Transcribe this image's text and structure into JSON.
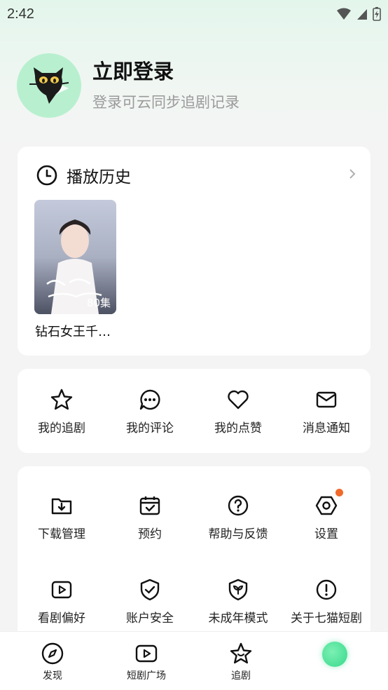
{
  "status_bar": {
    "time": "2:42"
  },
  "profile": {
    "title": "立即登录",
    "subtitle": "登录可云同步追剧记录"
  },
  "history": {
    "title": "播放历史",
    "items": [
      {
        "name": "钻石女王千…",
        "episodes": "80集"
      }
    ]
  },
  "actions": [
    {
      "label": "我的追剧",
      "icon": "star-icon"
    },
    {
      "label": "我的评论",
      "icon": "comment-icon"
    },
    {
      "label": "我的点赞",
      "icon": "heart-icon"
    },
    {
      "label": "消息通知",
      "icon": "mail-icon"
    }
  ],
  "settings": [
    {
      "label": "下载管理",
      "icon": "download-folder-icon"
    },
    {
      "label": "预约",
      "icon": "calendar-check-icon"
    },
    {
      "label": "帮助与反馈",
      "icon": "help-icon"
    },
    {
      "label": "设置",
      "icon": "gear-icon",
      "badge": true
    },
    {
      "label": "看剧偏好",
      "icon": "play-box-icon"
    },
    {
      "label": "账户安全",
      "icon": "shield-check-icon"
    },
    {
      "label": "未成年模式",
      "icon": "youth-shield-icon"
    },
    {
      "label": "关于七猫短剧",
      "icon": "info-icon"
    }
  ],
  "bottom_nav": [
    {
      "label": "发现",
      "icon": "compass-icon"
    },
    {
      "label": "短剧广场",
      "icon": "play-box-icon"
    },
    {
      "label": "追剧",
      "icon": "star-smile-icon"
    },
    {
      "label": "",
      "icon": "profile-dot-icon"
    }
  ],
  "colors": {
    "accent": "#3fdc90",
    "badge": "#f26a2a",
    "avatar_bg": "#b8f0cf"
  }
}
